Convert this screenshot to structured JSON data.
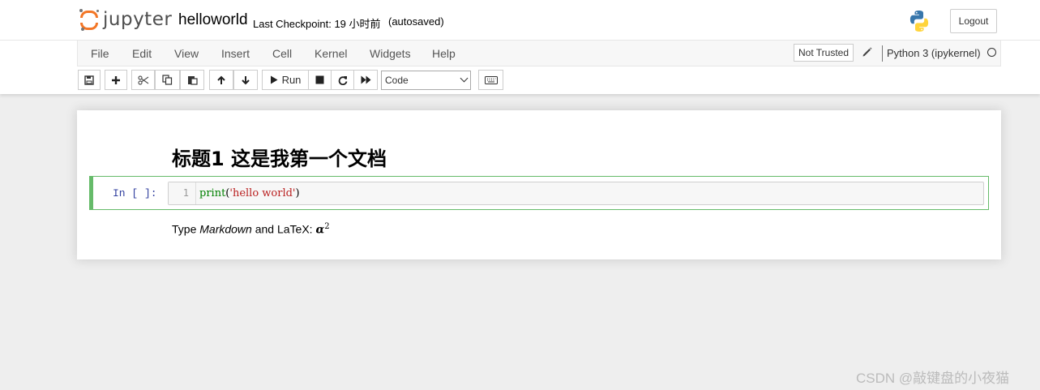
{
  "header": {
    "logo_text": "jupyter",
    "notebook_name": "helloworld",
    "checkpoint": "Last Checkpoint: 19 小时前",
    "autosave": "(autosaved)",
    "logout_label": "Logout"
  },
  "menubar": {
    "items": [
      "File",
      "Edit",
      "View",
      "Insert",
      "Cell",
      "Kernel",
      "Widgets",
      "Help"
    ],
    "trust_label": "Not Trusted",
    "kernel_name": "Python 3 (ipykernel)"
  },
  "toolbar": {
    "run_label": "Run",
    "cell_type": "Code"
  },
  "notebook": {
    "heading": "标题1 这是我第一个文档",
    "code_cell": {
      "prompt": "In [ ]:",
      "line_number": "1",
      "code_fn": "print",
      "code_open": "(",
      "code_str": "'hello world'",
      "code_close": ")"
    },
    "markdown": {
      "prefix": "Type ",
      "emphasis": "Markdown",
      "middle": " and LaTeX: ",
      "math_symbol": "α",
      "math_superscript": "2"
    }
  },
  "watermark": "CSDN @敲键盘的小夜猫",
  "colors": {
    "accent_orange": "#f37626",
    "cell_selected": "#66bb6a",
    "prompt_blue": "#303f9f",
    "code_green": "#008000",
    "string_red": "#ba2121"
  }
}
